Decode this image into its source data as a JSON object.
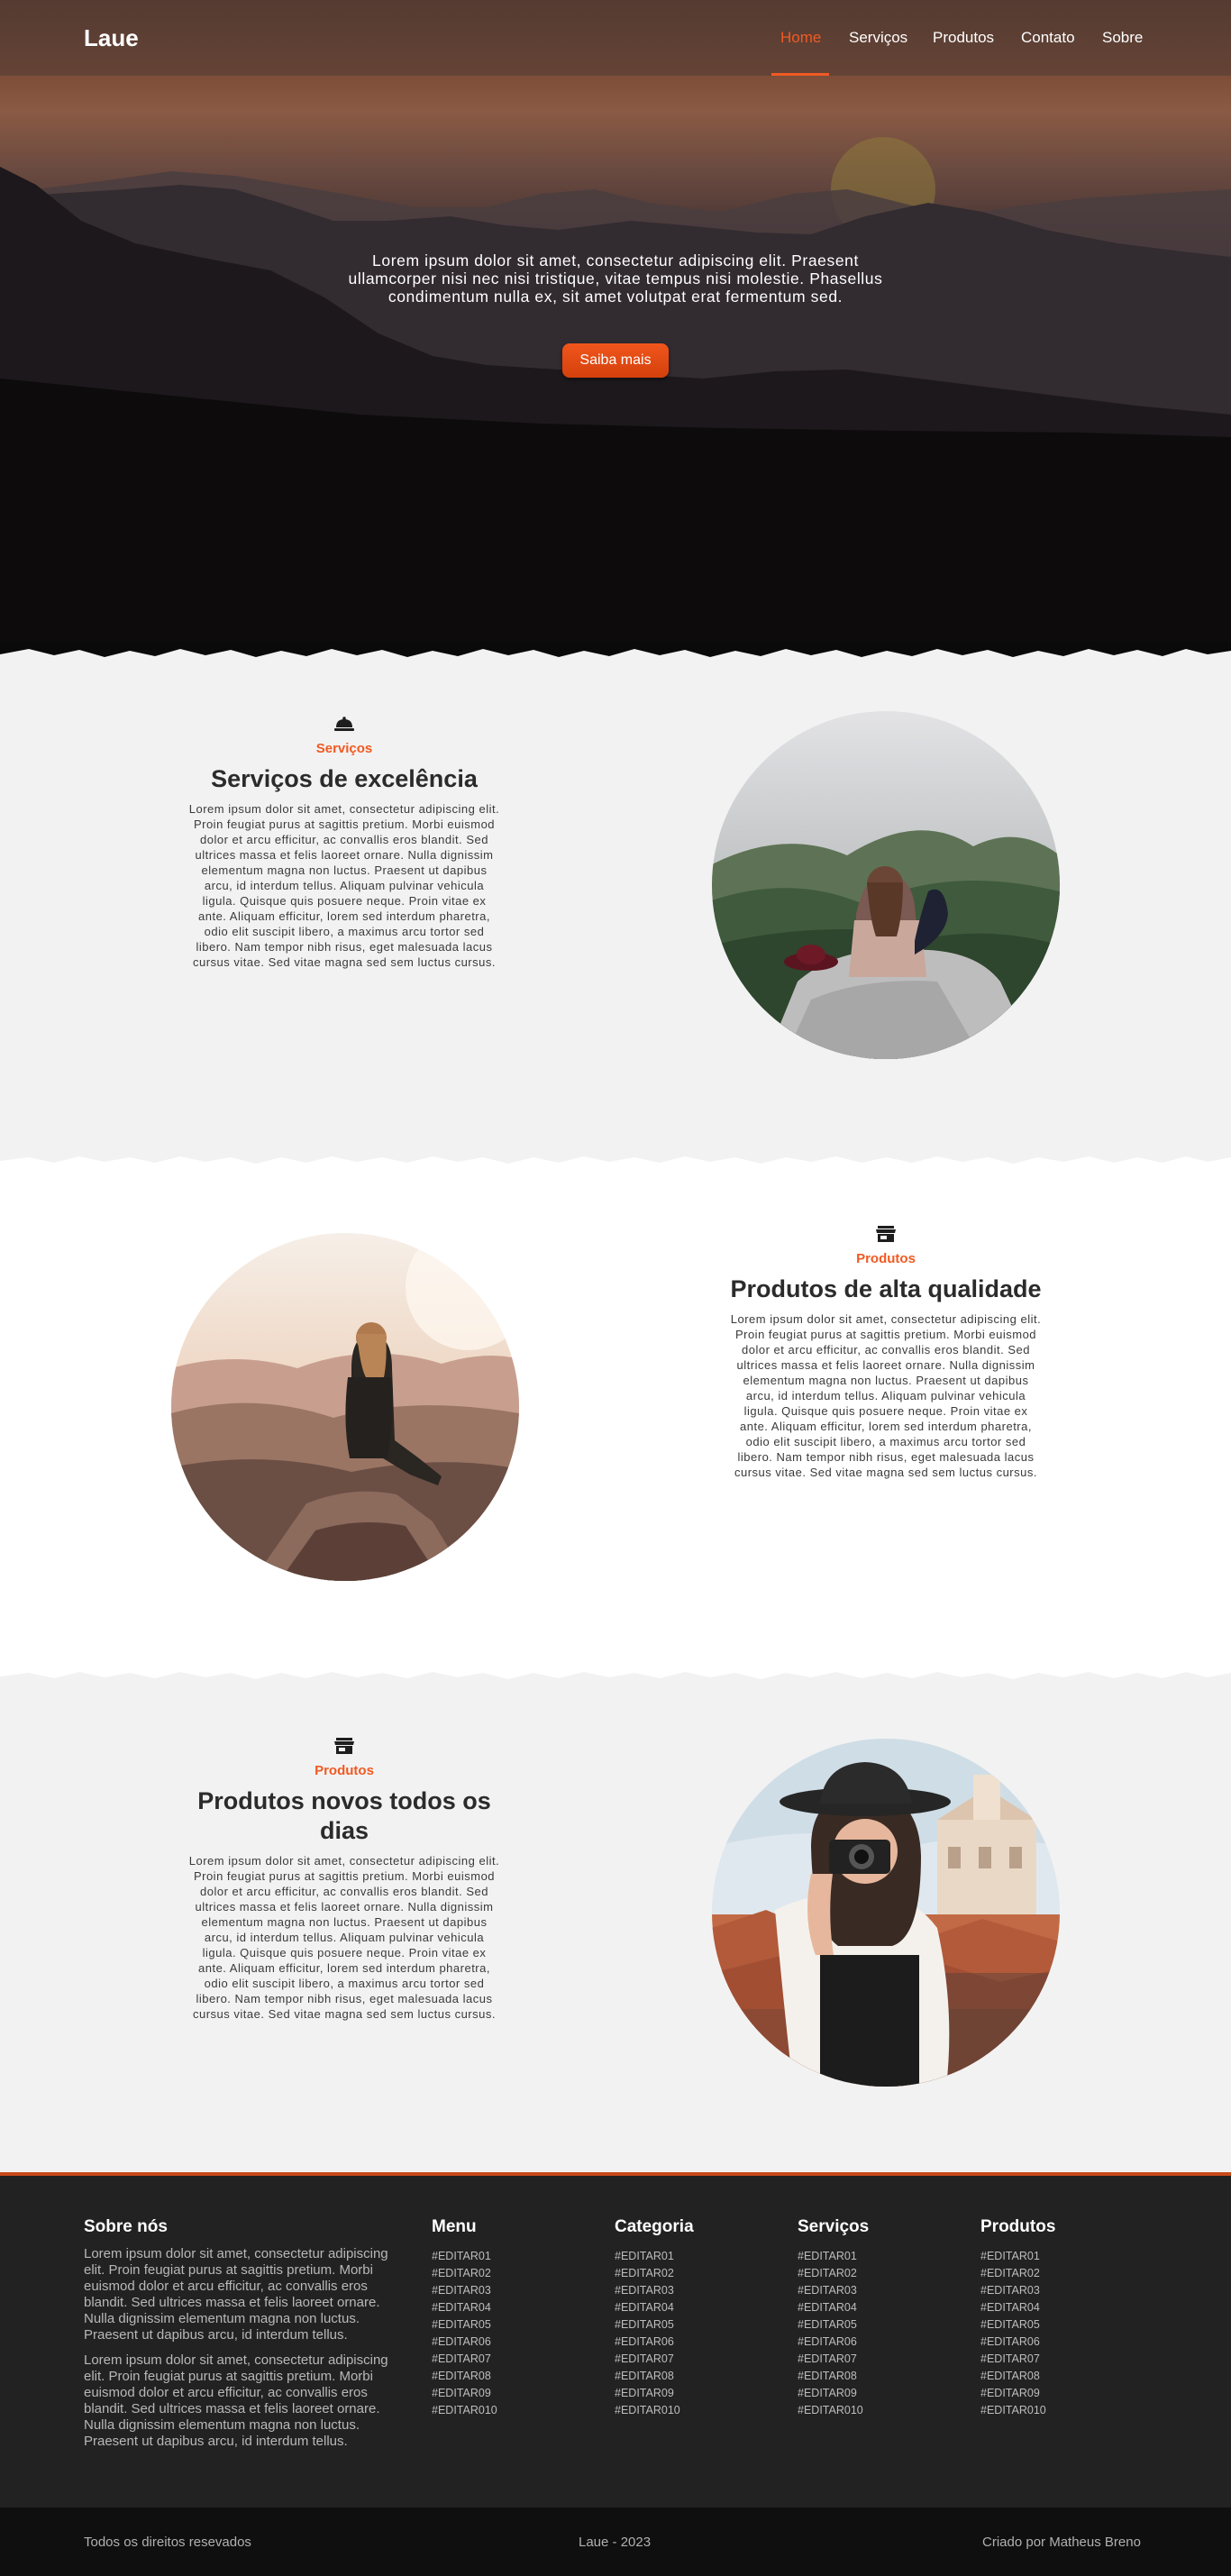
{
  "colors": {
    "accent": "#f15a22",
    "footer_bg": "#222222",
    "bottom_bar_bg": "#0f0f0f",
    "section_light": "#f2f2f2",
    "section_white": "#ffffff"
  },
  "nav": {
    "brand": "Laue",
    "items": [
      {
        "label": "Home",
        "active": true
      },
      {
        "label": "Serviços",
        "active": false
      },
      {
        "label": "Produtos",
        "active": false
      },
      {
        "label": "Contato",
        "active": false
      },
      {
        "label": "Sobre",
        "active": false
      }
    ]
  },
  "hero": {
    "text": "Lorem ipsum dolor sit amet, consectetur adipiscing elit. Praesent ullamcorper nisi nec nisi tristique, vitae tempus nisi molestie. Phasellus condimentum nulla ex, sit amet volutpat erat fermentum sed.",
    "button": "Saiba mais"
  },
  "sections": [
    {
      "icon": "bell-icon",
      "eyebrow": "Serviços",
      "heading": "Serviços de excelência",
      "body": "Lorem ipsum dolor sit amet, consectetur adipiscing elit. Proin feugiat purus at sagittis pretium. Morbi euismod dolor et arcu efficitur, ac convallis eros blandit. Sed ultrices massa et felis laoreet ornare. Nulla dignissim elementum magna non luctus. Praesent ut dapibus arcu, id interdum tellus. Aliquam pulvinar vehicula ligula. Quisque quis posuere neque. Proin vitae ex ante. Aliquam efficitur, lorem sed interdum pharetra, odio elit suscipit libero, a maximus arcu tortor sed libero. Nam tempor nibh risus, eget malesuada lacus cursus vitae. Sed vitae magna sed sem luctus cursus."
    },
    {
      "icon": "store-icon",
      "eyebrow": "Produtos",
      "heading": "Produtos de alta qualidade",
      "body": "Lorem ipsum dolor sit amet, consectetur adipiscing elit. Proin feugiat purus at sagittis pretium. Morbi euismod dolor et arcu efficitur, ac convallis eros blandit. Sed ultrices massa et felis laoreet ornare. Nulla dignissim elementum magna non luctus. Praesent ut dapibus arcu, id interdum tellus. Aliquam pulvinar vehicula ligula. Quisque quis posuere neque. Proin vitae ex ante. Aliquam efficitur, lorem sed interdum pharetra, odio elit suscipit libero, a maximus arcu tortor sed libero. Nam tempor nibh risus, eget malesuada lacus cursus vitae. Sed vitae magna sed sem luctus cursus."
    },
    {
      "icon": "store-icon",
      "eyebrow": "Produtos",
      "heading": "Produtos novos todos os dias",
      "body": "Lorem ipsum dolor sit amet, consectetur adipiscing elit. Proin feugiat purus at sagittis pretium. Morbi euismod dolor et arcu efficitur, ac convallis eros blandit. Sed ultrices massa et felis laoreet ornare. Nulla dignissim elementum magna non luctus. Praesent ut dapibus arcu, id interdum tellus. Aliquam pulvinar vehicula ligula. Quisque quis posuere neque. Proin vitae ex ante. Aliquam efficitur, lorem sed interdum pharetra, odio elit suscipit libero, a maximus arcu tortor sed libero. Nam tempor nibh risus, eget malesuada lacus cursus vitae. Sed vitae magna sed sem luctus cursus."
    }
  ],
  "footer": {
    "about": {
      "title": "Sobre nós",
      "p1": "Lorem ipsum dolor sit amet, consectetur adipiscing elit. Proin feugiat purus at sagittis pretium. Morbi euismod dolor et arcu efficitur, ac convallis eros blandit. Sed ultrices massa et felis laoreet ornare. Nulla dignissim elementum magna non luctus. Praesent ut dapibus arcu, id interdum tellus.",
      "p2": "Lorem ipsum dolor sit amet, consectetur adipiscing elit. Proin feugiat purus at sagittis pretium. Morbi euismod dolor et arcu efficitur, ac convallis eros blandit. Sed ultrices massa et felis laoreet ornare. Nulla dignissim elementum magna non luctus. Praesent ut dapibus arcu, id interdum tellus."
    },
    "columns": [
      {
        "title": "Menu",
        "links": [
          "#EDITAR01",
          "#EDITAR02",
          "#EDITAR03",
          "#EDITAR04",
          "#EDITAR05",
          "#EDITAR06",
          "#EDITAR07",
          "#EDITAR08",
          "#EDITAR09",
          "#EDITAR010"
        ]
      },
      {
        "title": "Categoria",
        "links": [
          "#EDITAR01",
          "#EDITAR02",
          "#EDITAR03",
          "#EDITAR04",
          "#EDITAR05",
          "#EDITAR06",
          "#EDITAR07",
          "#EDITAR08",
          "#EDITAR09",
          "#EDITAR010"
        ]
      },
      {
        "title": "Serviços",
        "links": [
          "#EDITAR01",
          "#EDITAR02",
          "#EDITAR03",
          "#EDITAR04",
          "#EDITAR05",
          "#EDITAR06",
          "#EDITAR07",
          "#EDITAR08",
          "#EDITAR09",
          "#EDITAR010"
        ]
      },
      {
        "title": "Produtos",
        "links": [
          "#EDITAR01",
          "#EDITAR02",
          "#EDITAR03",
          "#EDITAR04",
          "#EDITAR05",
          "#EDITAR06",
          "#EDITAR07",
          "#EDITAR08",
          "#EDITAR09",
          "#EDITAR010"
        ]
      }
    ]
  },
  "bottom_bar": {
    "rights": "Todos os direitos resevados",
    "center": "Laue - 2023",
    "credit": "Criado por Matheus Breno"
  }
}
